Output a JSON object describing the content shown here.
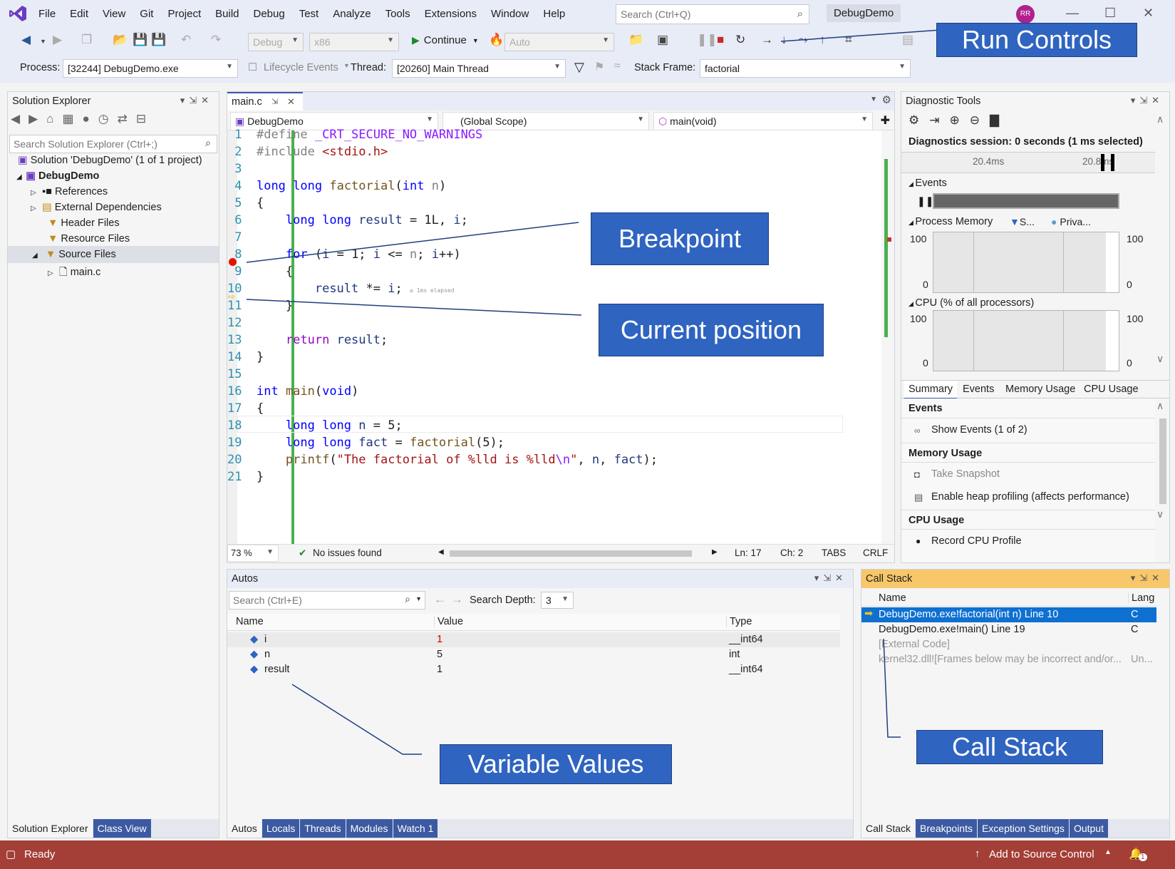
{
  "menubar": {
    "items": [
      "File",
      "Edit",
      "View",
      "Git",
      "Project",
      "Build",
      "Debug",
      "Test",
      "Analyze",
      "Tools",
      "Extensions",
      "Window",
      "Help"
    ],
    "search_placeholder": "Search (Ctrl+Q)",
    "solution_name": "DebugDemo",
    "avatar_initials": "RR"
  },
  "toolbar": {
    "config": "Debug",
    "platform": "x86",
    "continue_label": "Continue",
    "auto_label": "Auto",
    "process_label": "Process:",
    "process_value": "[32244] DebugDemo.exe",
    "lifecycle_label": "Lifecycle Events",
    "thread_label": "Thread:",
    "thread_value": "[20260] Main Thread",
    "stackframe_label": "Stack Frame:",
    "stackframe_value": "factorial"
  },
  "callouts": {
    "run_controls": "Run Controls",
    "breakpoint": "Breakpoint",
    "current_position": "Current position",
    "variable_values": "Variable Values",
    "call_stack": "Call Stack"
  },
  "solution_explorer": {
    "title": "Solution Explorer",
    "search_placeholder": "Search Solution Explorer (Ctrl+;)",
    "items": [
      "Solution 'DebugDemo' (1 of 1 project)",
      "DebugDemo",
      "References",
      "External Dependencies",
      "Header Files",
      "Resource Files",
      "Source Files",
      "main.c"
    ],
    "tabs": [
      "Solution Explorer",
      "Class View"
    ]
  },
  "editor": {
    "tab": "main.c",
    "project_dd": "DebugDemo",
    "scope_dd": "(Global Scope)",
    "member_dd": "main(void)",
    "elapsed": "≤ 1ms elapsed",
    "zoom": "73 %",
    "issues": "No issues found",
    "ln": "Ln: 17",
    "ch": "Ch: 2",
    "tabs": "TABS",
    "eol": "CRLF"
  },
  "diagnostic": {
    "title": "Diagnostic Tools",
    "session": "Diagnostics session: 0 seconds (1 ms selected)",
    "tick1": "20.4ms",
    "tick2": "20.8ms",
    "events_label": "Events",
    "process_memory_label": "Process Memory",
    "legend_s": "S...",
    "legend_p": "Priva...",
    "mem_max": "100",
    "mem_min": "0",
    "cpu_label": "CPU (% of all processors)",
    "cpu_max": "100",
    "cpu_min": "0",
    "tabs": [
      "Summary",
      "Events",
      "Memory Usage",
      "CPU Usage"
    ],
    "sec_events": "Events",
    "show_events": "Show Events (1 of 2)",
    "sec_memory": "Memory Usage",
    "take_snapshot": "Take Snapshot",
    "enable_heap": "Enable heap profiling (affects performance)",
    "sec_cpu": "CPU Usage",
    "record_cpu": "Record CPU Profile"
  },
  "autos": {
    "title": "Autos",
    "search_placeholder": "Search (Ctrl+E)",
    "depth_label": "Search Depth:",
    "depth_value": "3",
    "columns": [
      "Name",
      "Value",
      "Type"
    ],
    "rows": [
      {
        "name": "i",
        "value": "1",
        "type": "__int64"
      },
      {
        "name": "n",
        "value": "5",
        "type": "int"
      },
      {
        "name": "result",
        "value": "1",
        "type": "__int64"
      }
    ],
    "tabs": [
      "Autos",
      "Locals",
      "Threads",
      "Modules",
      "Watch 1"
    ]
  },
  "callstack": {
    "title": "Call Stack",
    "columns": [
      "Name",
      "Lang"
    ],
    "rows": [
      {
        "name": "DebugDemo.exe!factorial(int n) Line 10",
        "lang": "C"
      },
      {
        "name": "DebugDemo.exe!main() Line 19",
        "lang": "C"
      },
      {
        "name": "[External Code]",
        "lang": ""
      },
      {
        "name": "kernel32.dll![Frames below may be incorrect and/or...",
        "lang": "Un..."
      }
    ],
    "tabs": [
      "Call Stack",
      "Breakpoints",
      "Exception Settings",
      "Output"
    ]
  },
  "status": {
    "ready": "Ready",
    "source_control": "Add to Source Control",
    "badge": "1"
  }
}
